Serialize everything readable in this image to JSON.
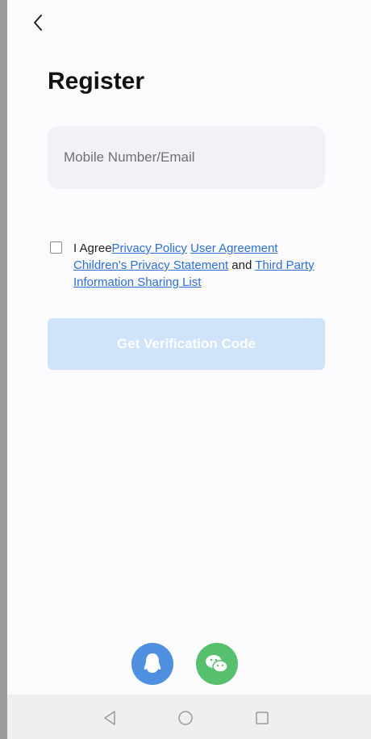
{
  "header": {
    "back_icon": "chevron-left-icon"
  },
  "page": {
    "title": "Register"
  },
  "form": {
    "account_placeholder": "Mobile Number/Email",
    "account_value": ""
  },
  "agreement": {
    "checked": false,
    "prefix": "I Agree",
    "privacy_policy": "Privacy Policy",
    "user_agreement": "User Agreement",
    "childrens_privacy": "Children's Privacy Statement",
    "and_text": "and",
    "third_party": "Third Party Information Sharing List"
  },
  "actions": {
    "get_code_label": "Get Verification Code"
  },
  "social": {
    "qq_icon": "qq-icon",
    "wechat_icon": "wechat-icon"
  },
  "navbar": {
    "back_icon": "triangle-back-icon",
    "home_icon": "circle-home-icon",
    "recents_icon": "square-recents-icon"
  },
  "colors": {
    "primary_disabled": "#cfe3fb",
    "link": "#2d6fd2",
    "qq": "#4f8fe0",
    "wechat": "#57c06e"
  }
}
